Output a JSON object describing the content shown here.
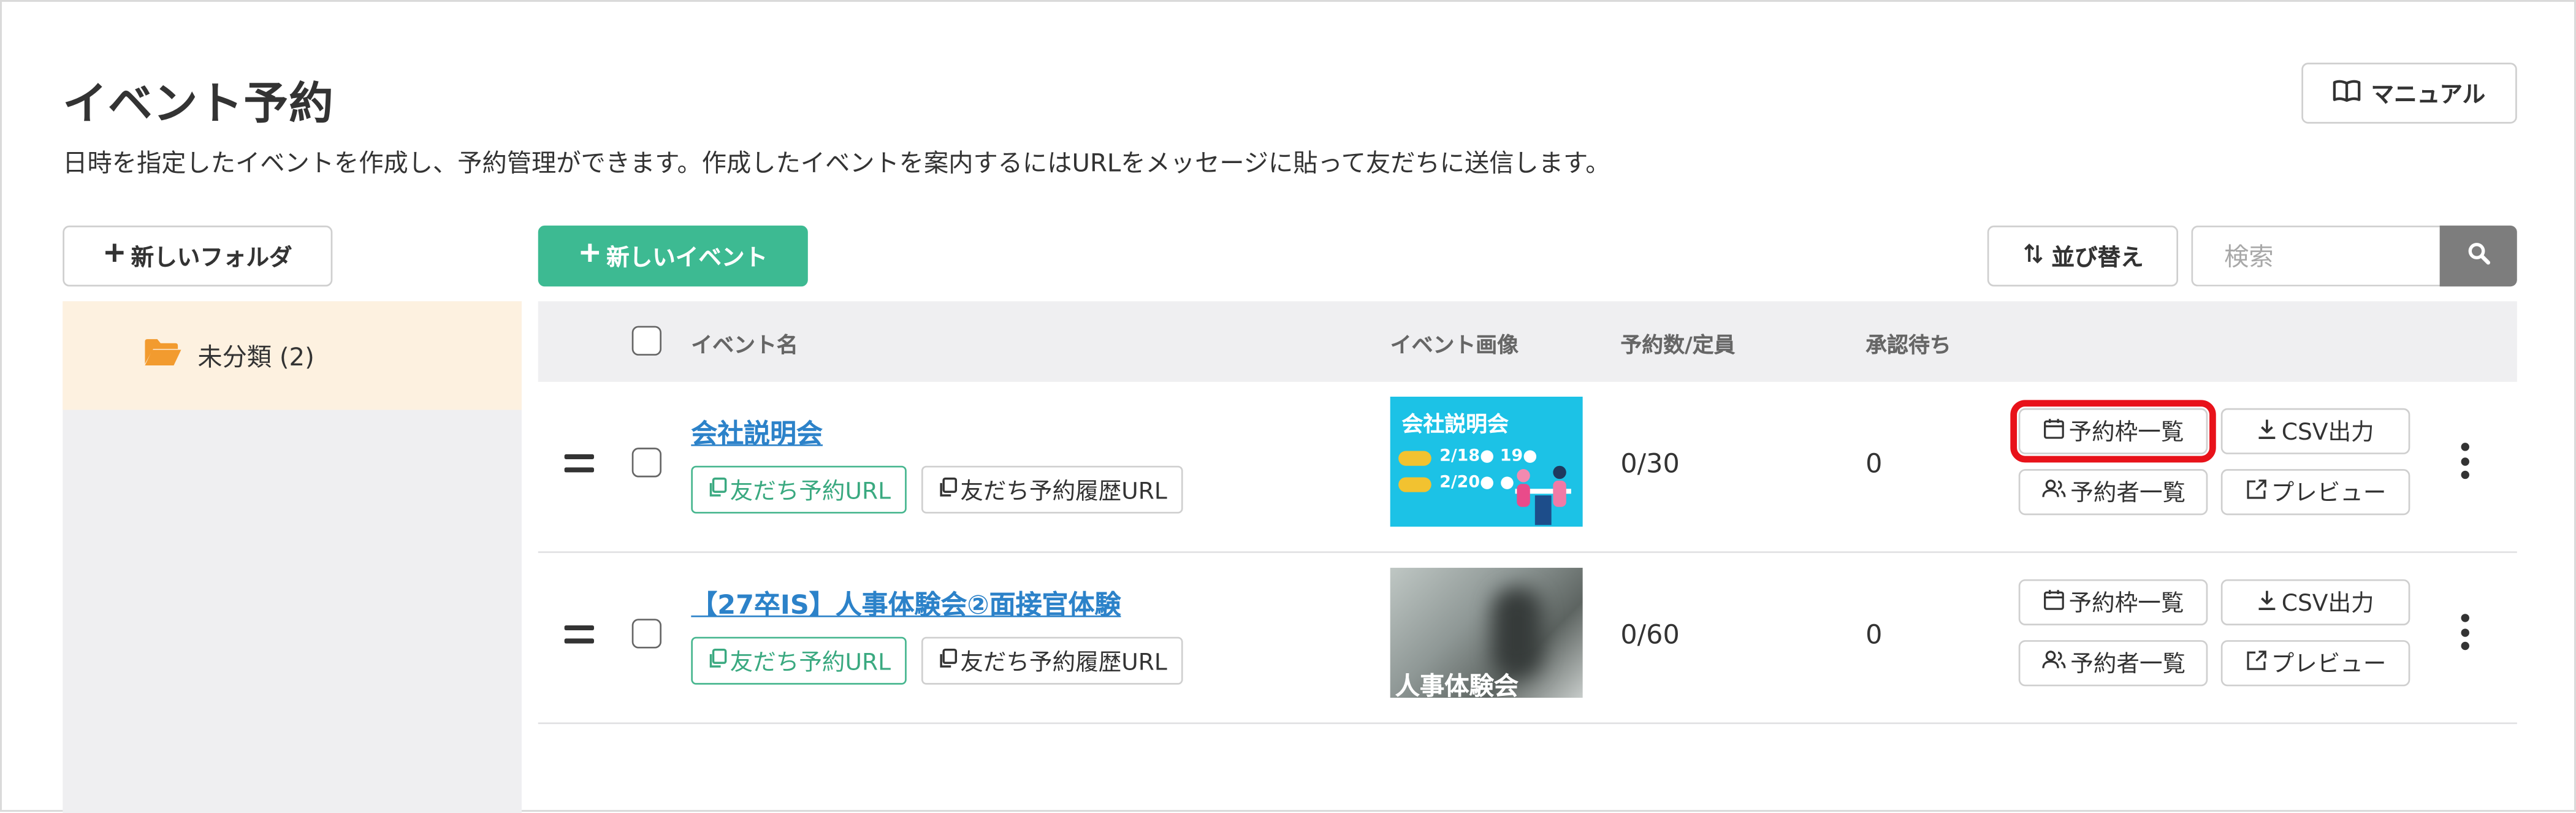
{
  "header": {
    "title": "イベント予約",
    "description": "日時を指定したイベントを作成し、予約管理ができます。作成したイベントを案内するにはURLをメッセージに貼って友だちに送信します。",
    "manual_label": "マニュアル"
  },
  "toolbar": {
    "new_folder_label": "新しいフォルダ",
    "new_event_label": "新しいイベント",
    "sort_label": "並び替え",
    "search_placeholder": "検索"
  },
  "sidebar": {
    "folders": [
      {
        "label": "未分類 (2)",
        "selected": true
      }
    ]
  },
  "table": {
    "headers": {
      "name": "イベント名",
      "image": "イベント画像",
      "reservations": "予約数/定員",
      "pending": "承認待ち"
    },
    "rows": [
      {
        "name": "会社説明会",
        "friend_url_label": "友だち予約URL",
        "history_url_label": "友だち予約履歴URL",
        "thumbnail": {
          "title": "会社説明会",
          "line1": "2/18● 19●",
          "line2": "2/20● ●"
        },
        "reservations": "0/30",
        "pending": "0",
        "actions": {
          "slots": "予約枠一覧",
          "csv": "CSV出力",
          "reservers": "予約者一覧",
          "preview": "プレビュー"
        }
      },
      {
        "name": "【27卒IS】人事体験会②面接官体験",
        "friend_url_label": "友だち予約URL",
        "history_url_label": "友だち予約履歴URL",
        "thumbnail": {
          "text": "人事体験会"
        },
        "reservations": "0/60",
        "pending": "0",
        "actions": {
          "slots": "予約枠一覧",
          "csv": "CSV出力",
          "reservers": "予約者一覧",
          "preview": "プレビュー"
        }
      }
    ]
  },
  "colors": {
    "primary_green": "#3dba92",
    "link_blue": "#2c82c9",
    "folder_orange": "#f29b2f",
    "selected_folder_bg": "#fdf1e0",
    "highlight_red": "#e8121a",
    "search_button_gray": "#7d7d7d"
  },
  "icons": {
    "manual": "book-open-icon",
    "new_folder": "plus-icon",
    "new_event": "plus-icon",
    "sort": "sort-arrows-icon",
    "search": "search-icon",
    "folder": "folder-open-icon",
    "drag": "drag-handle-icon",
    "copy": "copy-icon",
    "calendar": "calendar-icon",
    "download": "download-icon",
    "users": "users-icon",
    "preview": "external-preview-icon",
    "more": "kebab-menu-icon"
  },
  "highlight": {
    "target": "row-1 予約枠一覧"
  }
}
